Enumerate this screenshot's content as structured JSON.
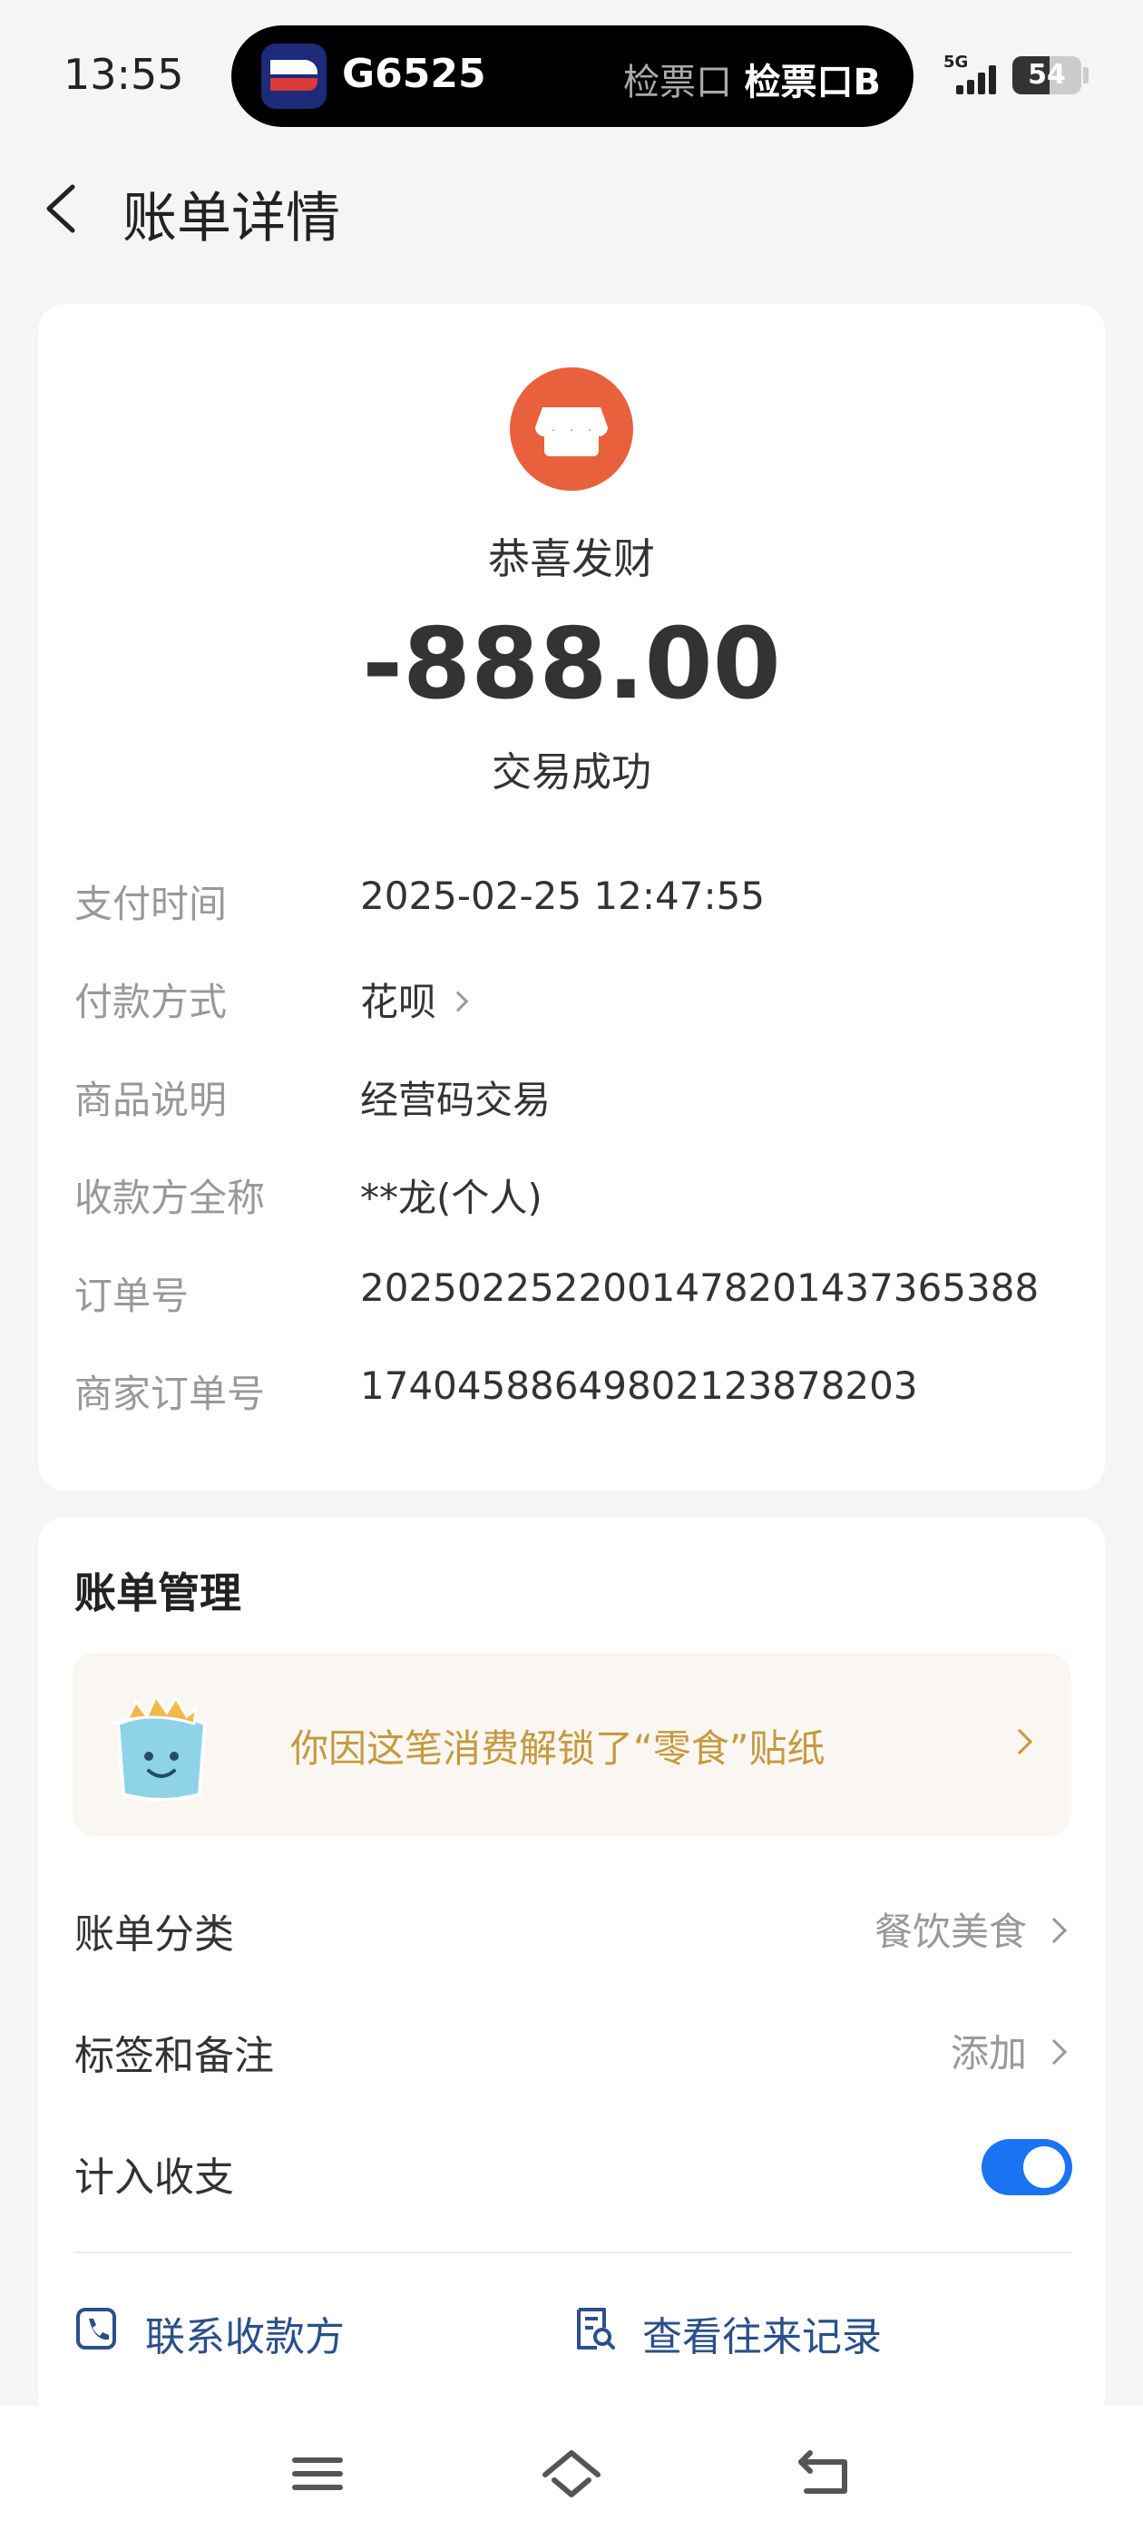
{
  "status_bar": {
    "time": "13:55",
    "train_number": "G6525",
    "gate_label": "检票口",
    "gate_value": "检票口B",
    "network": "5G",
    "battery": "54"
  },
  "nav": {
    "title": "账单详情"
  },
  "summary": {
    "merchant_name": "恭喜发财",
    "amount": "-888.00",
    "status": "交易成功",
    "merchant_icon_color": "#e8603c"
  },
  "details": [
    {
      "key": "支付时间",
      "value": "2025-02-25 12:47:55"
    },
    {
      "key": "付款方式",
      "value": "花呗"
    },
    {
      "key": "商品说明",
      "value": "经营码交易"
    },
    {
      "key": "收款方全称",
      "value": "**龙(个人)"
    },
    {
      "key": "订单号",
      "value": "2025022522001478201437365388"
    },
    {
      "key": "商家订单号",
      "value": "17404588649802123878203"
    }
  ],
  "management": {
    "title": "账单管理",
    "sticker_text": "你因这笔消费解锁了“零食”贴纸",
    "category_label": "账单分类",
    "category_value": "餐饮美食",
    "tags_label": "标签和备注",
    "tags_value": "添加",
    "include_label": "计入收支",
    "include_enabled": true,
    "contact_label": "联系收款方",
    "records_label": "查看往来记录"
  },
  "colors": {
    "accent": "#1a73f0",
    "link": "#2a4f8a",
    "sticker_text": "#c49a40"
  }
}
